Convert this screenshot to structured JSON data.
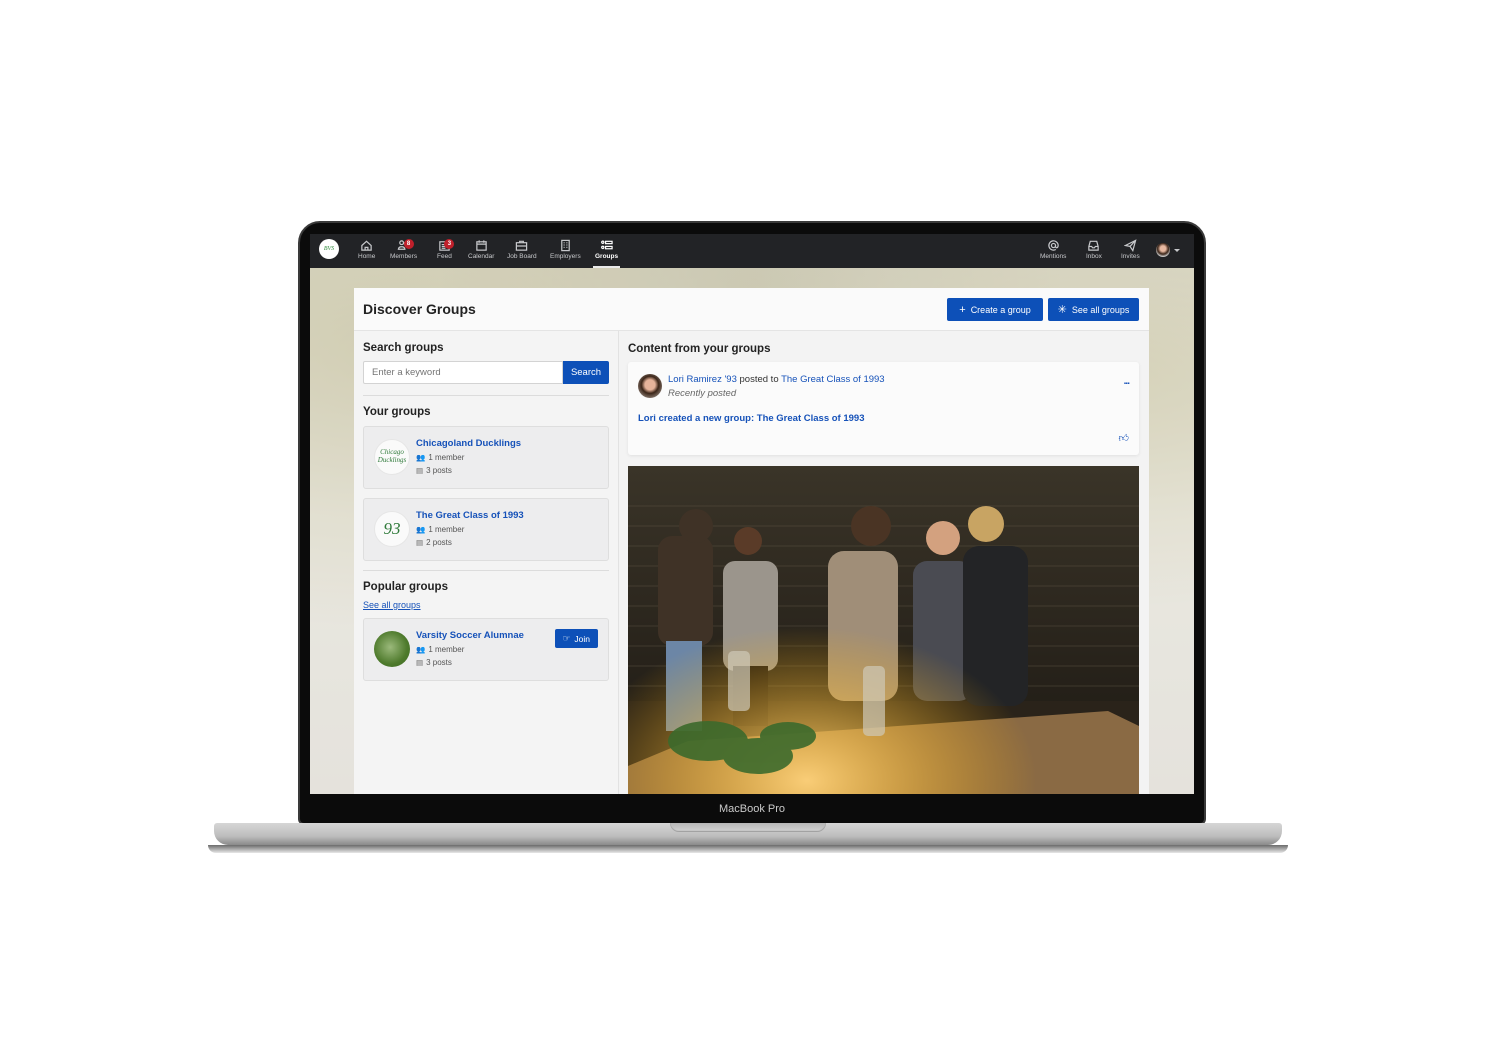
{
  "device": {
    "label": "MacBook Pro"
  },
  "topbar": {
    "logo_text": "BVS",
    "nav": [
      {
        "label": "Home",
        "icon": "home-icon"
      },
      {
        "label": "Members",
        "icon": "members-icon",
        "badge": "8"
      },
      {
        "label": "Feed",
        "icon": "feed-icon",
        "badge": "3"
      },
      {
        "label": "Calendar",
        "icon": "calendar-icon"
      },
      {
        "label": "Job Board",
        "icon": "briefcase-icon"
      },
      {
        "label": "Employers",
        "icon": "building-icon"
      },
      {
        "label": "Groups",
        "icon": "groups-icon",
        "active": true
      }
    ],
    "right_nav": [
      {
        "label": "Mentions",
        "icon": "at-icon"
      },
      {
        "label": "Inbox",
        "icon": "inbox-icon"
      },
      {
        "label": "Invites",
        "icon": "paper-plane-icon"
      }
    ]
  },
  "page": {
    "title": "Discover Groups",
    "create_button": "Create a group",
    "see_all_button": "See all groups"
  },
  "search": {
    "heading": "Search groups",
    "placeholder": "Enter a keyword",
    "button": "Search"
  },
  "your_groups": {
    "heading": "Your groups",
    "items": [
      {
        "name": "Chicagoland Ducklings",
        "avatar_text": "Chicago Ducklings",
        "members": "1 member",
        "posts": "3 posts"
      },
      {
        "name": "The Great Class of 1993",
        "avatar_text": "93",
        "members": "1 member",
        "posts": "2 posts"
      }
    ]
  },
  "popular_groups": {
    "heading": "Popular groups",
    "see_all_link": "See all groups",
    "items": [
      {
        "name": "Varsity Soccer Alumnae",
        "members": "1 member",
        "posts": "3 posts",
        "join_label": "Join"
      }
    ]
  },
  "content": {
    "heading": "Content from your groups",
    "post": {
      "author": "Lori Ramirez '93",
      "verb": " posted to ",
      "group": "The Great Class of 1993",
      "time": "Recently posted",
      "body": "Lori created a new group: The Great Class of 1993",
      "more_label": "...",
      "like_icon": "thumbs-up-icon"
    }
  },
  "colors": {
    "primary": "#0d50b8",
    "link": "#1652b9",
    "badge": "#c0202b",
    "topbar": "#222326"
  }
}
